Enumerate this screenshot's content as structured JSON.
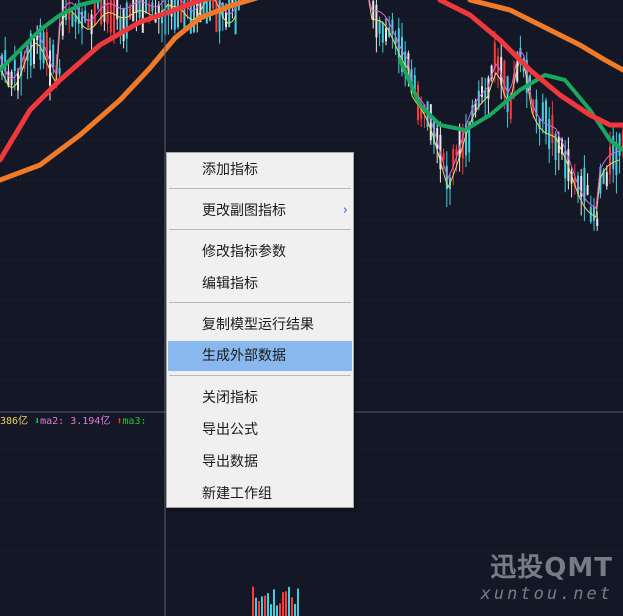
{
  "indicator": {
    "value1": "386亿",
    "arrow_down": "⬇",
    "ma2_text": "ma2: 3.194亿",
    "arrow_up": "⬆",
    "ma3_text": "ma3:"
  },
  "context_menu": {
    "items": [
      {
        "label": "添加指标"
      },
      {
        "label": "更改副图指标",
        "submenu_arrow": "›"
      },
      {
        "label": "修改指标参数"
      },
      {
        "label": "编辑指标"
      },
      {
        "label": "复制模型运行结果"
      },
      {
        "label": "生成外部数据"
      },
      {
        "label": "关闭指标"
      },
      {
        "label": "导出公式"
      },
      {
        "label": "导出数据"
      },
      {
        "label": "新建工作组"
      }
    ],
    "highlighted_item": "生成外部数据"
  },
  "watermark": {
    "main": "迅投QMT",
    "sub": "xuntou.net"
  },
  "colors": {
    "background": "#141826",
    "grid": "#2a3040",
    "ma_red": "#f0383c",
    "ma_orange": "#f07a28",
    "ma_green": "#18a860",
    "candle_up": "#e8e8e8",
    "candle_cyan": "#40d0e0",
    "candle_red": "#ff3838",
    "thin_yellow": "#e8d860",
    "thin_magenta": "#e060e0",
    "menu_highlight": "#89b8ef"
  }
}
